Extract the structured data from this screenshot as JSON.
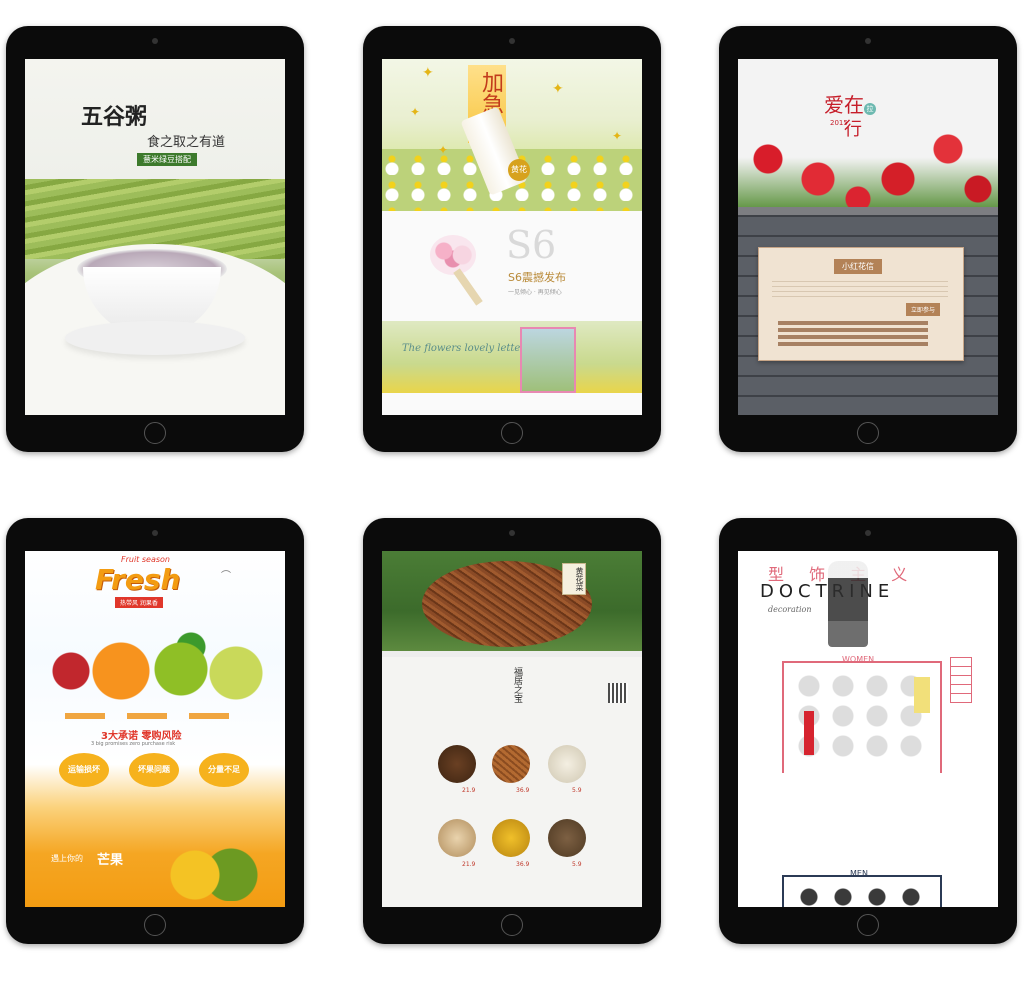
{
  "t1": {
    "title": "五谷粥",
    "subtitle": "食之取之有道",
    "tag": "薏米绿豆搭配"
  },
  "t2": {
    "banner": "加急函",
    "scroll_seal": "黄花",
    "product": "S6",
    "product_caption": "S6震撼发布",
    "product_sub": "一见倾心 · 再见倾心",
    "script_text": "The flowers lovely letter"
  },
  "t3": {
    "title": "爱在",
    "title2": "行",
    "badge": "拉",
    "year": "2015",
    "panel_title": "小红花信",
    "panel_button": "立即参与"
  },
  "t4": {
    "script": "Fruit season",
    "title": "Fresh",
    "tagline": "热带风 润果香",
    "promise": "3大承诺 零购风险",
    "promise_en": "3 big promises zero purchase risk",
    "btn1": "运输损坏",
    "btn2": "坏果问题",
    "btn3": "分量不足",
    "mango": "芒果",
    "mango_prefix": "遇上你的"
  },
  "t5": {
    "seal": "黄花菜",
    "logo": "福居之宝",
    "price1": "21.9",
    "price2": "36.9",
    "price3": "5.9",
    "price4": "21.9",
    "price5": "36.9",
    "price6": "5.9"
  },
  "t6": {
    "title_cn": "型 饰 主 义",
    "title_en": "DOCTRINE",
    "script": "decoration",
    "women": "WOMEN",
    "men": "MEN"
  }
}
